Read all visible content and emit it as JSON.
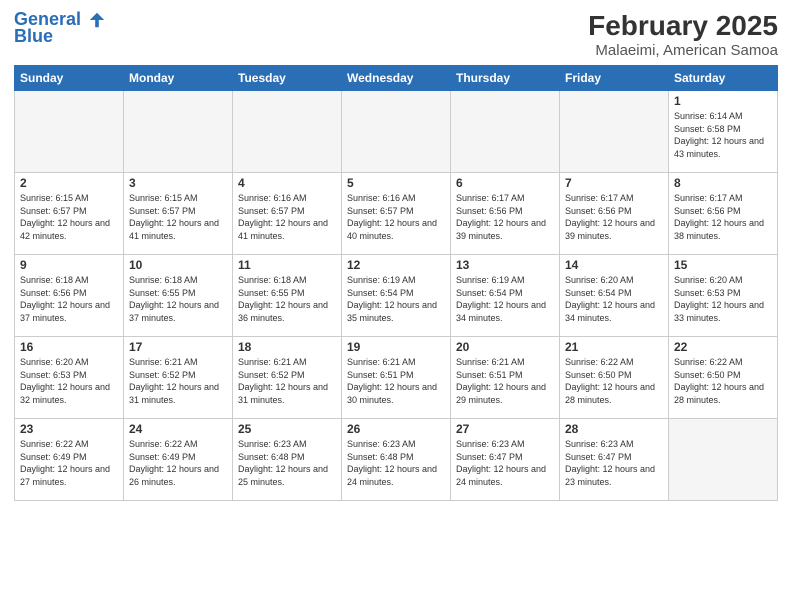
{
  "header": {
    "logo_line1": "General",
    "logo_line2": "Blue",
    "month": "February 2025",
    "location": "Malaeimi, American Samoa"
  },
  "days_of_week": [
    "Sunday",
    "Monday",
    "Tuesday",
    "Wednesday",
    "Thursday",
    "Friday",
    "Saturday"
  ],
  "weeks": [
    [
      {
        "day": "",
        "info": ""
      },
      {
        "day": "",
        "info": ""
      },
      {
        "day": "",
        "info": ""
      },
      {
        "day": "",
        "info": ""
      },
      {
        "day": "",
        "info": ""
      },
      {
        "day": "",
        "info": ""
      },
      {
        "day": "1",
        "info": "Sunrise: 6:14 AM\nSunset: 6:58 PM\nDaylight: 12 hours and 43 minutes."
      }
    ],
    [
      {
        "day": "2",
        "info": "Sunrise: 6:15 AM\nSunset: 6:57 PM\nDaylight: 12 hours and 42 minutes."
      },
      {
        "day": "3",
        "info": "Sunrise: 6:15 AM\nSunset: 6:57 PM\nDaylight: 12 hours and 41 minutes."
      },
      {
        "day": "4",
        "info": "Sunrise: 6:16 AM\nSunset: 6:57 PM\nDaylight: 12 hours and 41 minutes."
      },
      {
        "day": "5",
        "info": "Sunrise: 6:16 AM\nSunset: 6:57 PM\nDaylight: 12 hours and 40 minutes."
      },
      {
        "day": "6",
        "info": "Sunrise: 6:17 AM\nSunset: 6:56 PM\nDaylight: 12 hours and 39 minutes."
      },
      {
        "day": "7",
        "info": "Sunrise: 6:17 AM\nSunset: 6:56 PM\nDaylight: 12 hours and 39 minutes."
      },
      {
        "day": "8",
        "info": "Sunrise: 6:17 AM\nSunset: 6:56 PM\nDaylight: 12 hours and 38 minutes."
      }
    ],
    [
      {
        "day": "9",
        "info": "Sunrise: 6:18 AM\nSunset: 6:56 PM\nDaylight: 12 hours and 37 minutes."
      },
      {
        "day": "10",
        "info": "Sunrise: 6:18 AM\nSunset: 6:55 PM\nDaylight: 12 hours and 37 minutes."
      },
      {
        "day": "11",
        "info": "Sunrise: 6:18 AM\nSunset: 6:55 PM\nDaylight: 12 hours and 36 minutes."
      },
      {
        "day": "12",
        "info": "Sunrise: 6:19 AM\nSunset: 6:54 PM\nDaylight: 12 hours and 35 minutes."
      },
      {
        "day": "13",
        "info": "Sunrise: 6:19 AM\nSunset: 6:54 PM\nDaylight: 12 hours and 34 minutes."
      },
      {
        "day": "14",
        "info": "Sunrise: 6:20 AM\nSunset: 6:54 PM\nDaylight: 12 hours and 34 minutes."
      },
      {
        "day": "15",
        "info": "Sunrise: 6:20 AM\nSunset: 6:53 PM\nDaylight: 12 hours and 33 minutes."
      }
    ],
    [
      {
        "day": "16",
        "info": "Sunrise: 6:20 AM\nSunset: 6:53 PM\nDaylight: 12 hours and 32 minutes."
      },
      {
        "day": "17",
        "info": "Sunrise: 6:21 AM\nSunset: 6:52 PM\nDaylight: 12 hours and 31 minutes."
      },
      {
        "day": "18",
        "info": "Sunrise: 6:21 AM\nSunset: 6:52 PM\nDaylight: 12 hours and 31 minutes."
      },
      {
        "day": "19",
        "info": "Sunrise: 6:21 AM\nSunset: 6:51 PM\nDaylight: 12 hours and 30 minutes."
      },
      {
        "day": "20",
        "info": "Sunrise: 6:21 AM\nSunset: 6:51 PM\nDaylight: 12 hours and 29 minutes."
      },
      {
        "day": "21",
        "info": "Sunrise: 6:22 AM\nSunset: 6:50 PM\nDaylight: 12 hours and 28 minutes."
      },
      {
        "day": "22",
        "info": "Sunrise: 6:22 AM\nSunset: 6:50 PM\nDaylight: 12 hours and 28 minutes."
      }
    ],
    [
      {
        "day": "23",
        "info": "Sunrise: 6:22 AM\nSunset: 6:49 PM\nDaylight: 12 hours and 27 minutes."
      },
      {
        "day": "24",
        "info": "Sunrise: 6:22 AM\nSunset: 6:49 PM\nDaylight: 12 hours and 26 minutes."
      },
      {
        "day": "25",
        "info": "Sunrise: 6:23 AM\nSunset: 6:48 PM\nDaylight: 12 hours and 25 minutes."
      },
      {
        "day": "26",
        "info": "Sunrise: 6:23 AM\nSunset: 6:48 PM\nDaylight: 12 hours and 24 minutes."
      },
      {
        "day": "27",
        "info": "Sunrise: 6:23 AM\nSunset: 6:47 PM\nDaylight: 12 hours and 24 minutes."
      },
      {
        "day": "28",
        "info": "Sunrise: 6:23 AM\nSunset: 6:47 PM\nDaylight: 12 hours and 23 minutes."
      },
      {
        "day": "",
        "info": ""
      }
    ]
  ]
}
